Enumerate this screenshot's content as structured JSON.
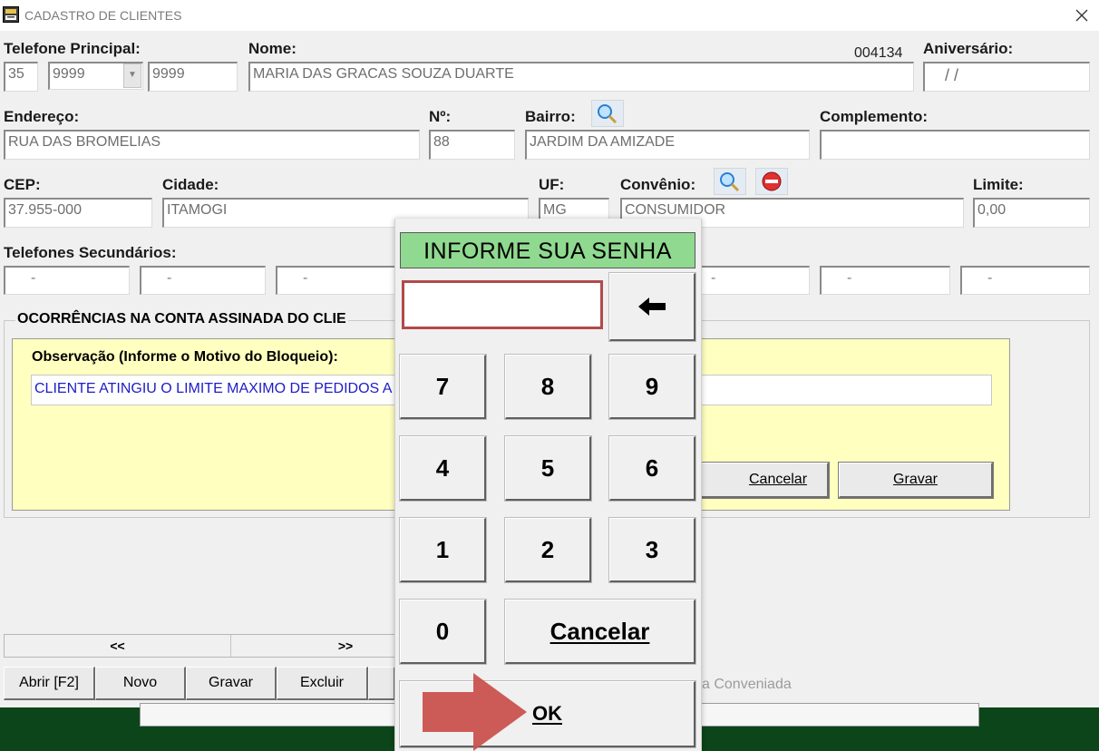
{
  "window": {
    "title": "CADASTRO DE CLIENTES"
  },
  "labels": {
    "telefone_principal": "Telefone Principal:",
    "nome": "Nome:",
    "aniversario": "Aniversário:",
    "endereco": "Endereço:",
    "numero": "Nº:",
    "bairro": "Bairro:",
    "complemento": "Complemento:",
    "cep": "CEP:",
    "cidade": "Cidade:",
    "uf": "UF:",
    "convenio": "Convênio:",
    "limite": "Limite:",
    "telefones_secundarios": "Telefones Secundários:"
  },
  "client": {
    "code": "004134",
    "ddd": "35",
    "phone_prefix": "9999",
    "phone_suffix": "9999",
    "name": "MARIA DAS GRACAS SOUZA DUARTE",
    "birthday": "/ /",
    "address": "RUA DAS BROMELIAS",
    "number": "88",
    "neighborhood": "JARDIM DA AMIZADE",
    "complement": "",
    "cep": "37.955-000",
    "city": "ITAMOGI",
    "uf": "MG",
    "agreement": "CONSUMIDOR",
    "limit": "0,00"
  },
  "secondary_phones": [
    "-",
    "-",
    "-",
    "-",
    "-",
    "-"
  ],
  "occurrences": {
    "title": "OCORRÊNCIAS NA CONTA ASSINADA DO CLIE",
    "obs_label": "Observação (Informe o Motivo do Bloqueio):",
    "obs_value": "CLIENTE ATINGIU O LIMITE MAXIMO DE PEDIDOS A",
    "cancel_label": "Cancelar",
    "save_label": "Gravar"
  },
  "nav": {
    "prev": "<<",
    "next": ">>"
  },
  "toolbar": {
    "open": "Abrir [F2]",
    "new": "Novo",
    "save": "Gravar",
    "delete": "Excluir",
    "conveniada_text": "sa Conveniada"
  },
  "password_dialog": {
    "title": "INFORME SUA SENHA",
    "backspace_icon": "arrow-left-icon",
    "keys": [
      "7",
      "8",
      "9",
      "4",
      "5",
      "6",
      "1",
      "2",
      "3",
      "0"
    ],
    "cancel": "Cancelar",
    "ok": "OK"
  },
  "colors": {
    "title_green": "#90d990",
    "input_border_red": "#b24a4a",
    "yellow_panel": "#ffffc0",
    "arrow_red": "#c9524f",
    "bottom_green": "#0b4519"
  }
}
